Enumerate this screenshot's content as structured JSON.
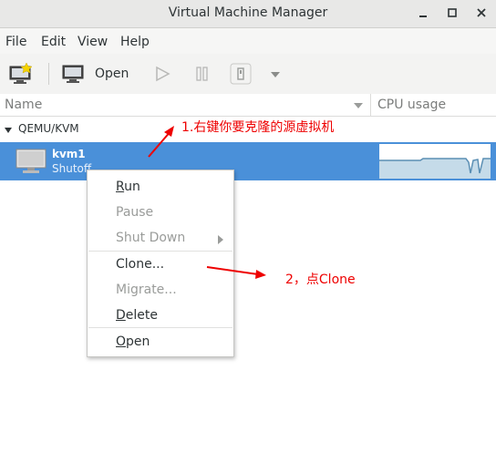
{
  "window": {
    "title": "Virtual Machine Manager"
  },
  "menu": {
    "file": "File",
    "edit": "Edit",
    "view": "View",
    "help": "Help"
  },
  "toolbar": {
    "open_label": "Open"
  },
  "columns": {
    "name": "Name",
    "cpu": "CPU usage"
  },
  "group": {
    "label": "QEMU/KVM"
  },
  "vm": {
    "name": "kvm1",
    "status": "Shutoff"
  },
  "context_menu": {
    "items": [
      {
        "label": "Run",
        "enabled": true
      },
      {
        "label": "Pause",
        "enabled": false
      },
      {
        "label": "Shut Down",
        "enabled": false
      },
      {
        "label": "Clone...",
        "enabled": true
      },
      {
        "label": "Migrate...",
        "enabled": false
      },
      {
        "label": "Delete",
        "enabled": true
      },
      {
        "label": "Open",
        "enabled": true
      }
    ]
  },
  "annotations": {
    "step1": "1.右键你要克隆的源虚拟机",
    "step2": "2，点Clone"
  },
  "colors": {
    "selection": "#4a90d9",
    "annotation": "#ee0000"
  }
}
